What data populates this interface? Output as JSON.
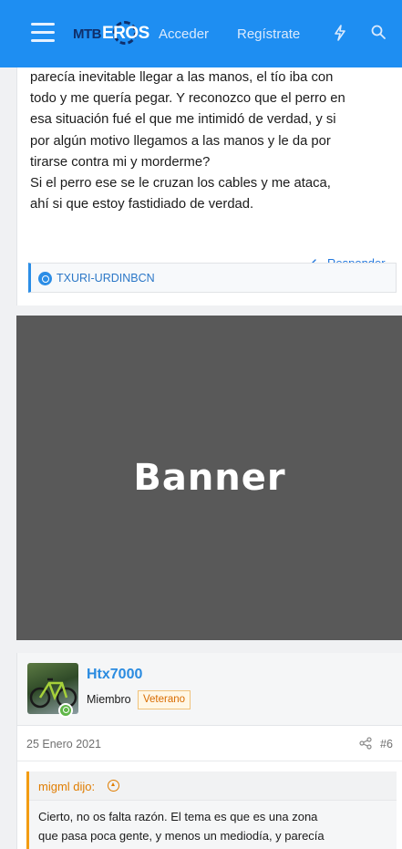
{
  "header": {
    "logo_mtb": "MTB",
    "logo_eros": "EROS",
    "login_label": "Acceder",
    "register_label": "Regístrate",
    "menu_icon": "hamburger-icon",
    "whats_new_icon": "bolt-icon",
    "search_icon": "search-icon",
    "brand_color": "#1e8ef2"
  },
  "post1": {
    "lines": [
      "parecía inevitable llegar a las manos, el tío iba con",
      "todo y me quería pegar. Y reconozco que el perro en",
      "esa situación fué el que me intimidó de verdad, y si",
      "por algún motivo llegamos a las manos y le da por",
      "tirarse contra mi y morderme?",
      "Si el perro ese se le cruzan los cables y me ataca,",
      "ahí si que estoy fastidiado de verdad."
    ],
    "reply_label": "Responder",
    "reaction_user": "TXURI-URDINBCN"
  },
  "banner": {
    "text": "Banner"
  },
  "post2": {
    "author": "Htx7000",
    "role": "Miembro",
    "badge": "Veterano",
    "date": "25 Enero 2021",
    "post_number": "#6",
    "quote_author": "migml dijo:",
    "quote_lines": [
      "Cierto, no os falta razón. El tema es que es una zona",
      "que pasa poca gente, y menos un mediodía, y parecía"
    ]
  }
}
